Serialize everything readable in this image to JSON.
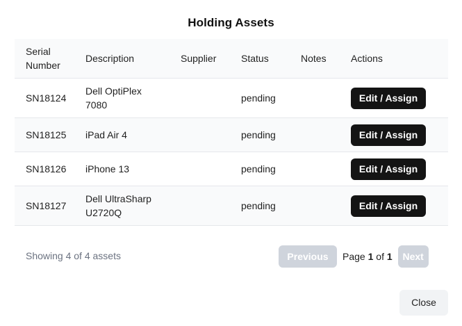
{
  "modal": {
    "title": "Holding Assets",
    "columns": [
      "Serial",
      "Number",
      "Description",
      "Supplier",
      "Status",
      "Notes",
      "Actions"
    ],
    "rows": [
      {
        "serial": "SN18124",
        "desc_line1": "Dell OptiPlex",
        "desc_line2": "7080",
        "supplier": "",
        "status": "pending",
        "notes": "",
        "action": "Edit / Assign"
      },
      {
        "serial": "SN18125",
        "desc_line1": "iPad Air 4",
        "desc_line2": "",
        "supplier": "",
        "status": "pending",
        "notes": "",
        "action": "Edit / Assign"
      },
      {
        "serial": "SN18126",
        "desc_line1": "iPhone 13",
        "desc_line2": "",
        "supplier": "",
        "status": "pending",
        "notes": "",
        "action": "Edit / Assign"
      },
      {
        "serial": "SN18127",
        "desc_line1": "Dell UltraSharp",
        "desc_line2": "U2720Q",
        "supplier": "",
        "status": "pending",
        "notes": "",
        "action": "Edit / Assign"
      }
    ],
    "footer": {
      "count_text": "Showing 4 of 4 assets",
      "previous_label": "Previous",
      "page_label": "Page",
      "page_current": "1",
      "page_of": "of",
      "page_total": "1",
      "next_label": "Next"
    },
    "close_label": "Close",
    "colors": {
      "primary_button": "#141414",
      "disabled_button": "#cfd4dc",
      "row_alt": "#f9fafb"
    }
  }
}
